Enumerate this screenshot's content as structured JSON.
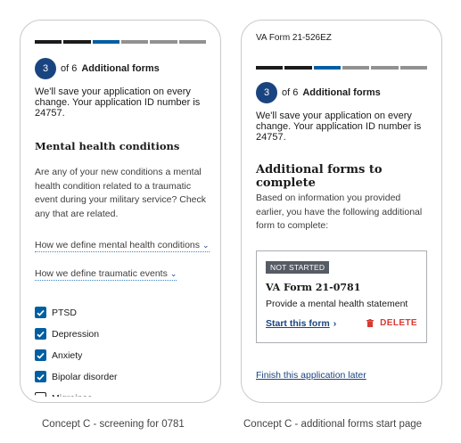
{
  "colors": {
    "primary": "#1a4480",
    "progress_done": "#1b1b1b",
    "progress_current": "#005ea2",
    "progress_todo": "#919191",
    "delete_red": "#d83933",
    "badge_gray": "#565c65"
  },
  "left": {
    "progress": [
      "done",
      "done",
      "current",
      "todo",
      "todo",
      "todo"
    ],
    "step_number": "3",
    "step_of": "of 6",
    "step_title": "Additional forms",
    "save_note": "We'll save your application on every change. Your application ID number is 24757.",
    "heading": "Mental health conditions",
    "question": "Are any of your new conditions a mental health condition related to a traumatic event during your military service? Check any that are related.",
    "accordion_1": "How we define mental health conditions",
    "accordion_2": "How we define traumatic events",
    "chevron_icon": "chevron-down-icon",
    "conditions": [
      {
        "label": "PTSD",
        "checked": true
      },
      {
        "label": "Depression",
        "checked": true
      },
      {
        "label": "Anxiety",
        "checked": true
      },
      {
        "label": "Bipolar disorder",
        "checked": true
      },
      {
        "label": "Migraines",
        "checked": false
      }
    ]
  },
  "right": {
    "form_number": "VA Form 21-526EZ",
    "progress": [
      "done",
      "done",
      "current",
      "todo",
      "todo",
      "todo"
    ],
    "step_number": "3",
    "step_of": "of 6",
    "step_title": "Additional forms",
    "save_note": "We'll save your application on every change. Your application ID number is 24757.",
    "heading": "Additional forms to complete",
    "intro": "Based on information you provided earlier, you have the following additional form to complete:",
    "card": {
      "badge": "NOT STARTED",
      "title": "VA Form 21-0781",
      "description": "Provide a mental health statement",
      "start_link": "Start this form",
      "start_icon": "chevron-right-icon",
      "delete_label": "DELETE",
      "delete_icon": "trash-icon"
    },
    "finish_link": "Finish this application later"
  },
  "captions": {
    "left": "Concept C - screening for 0781",
    "right": "Concept C - additional forms start page"
  }
}
